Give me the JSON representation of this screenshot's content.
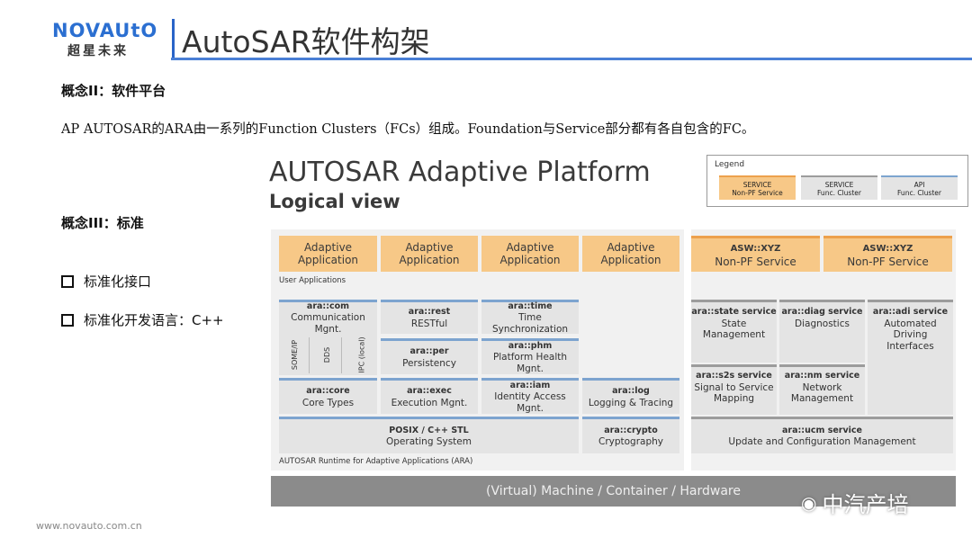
{
  "header": {
    "logo_top": "NOVAUtO",
    "logo_bottom": "超星未来",
    "title": "AutoSAR软件构架"
  },
  "concept2": "概念II：软件平台",
  "paragraph": "AP AUTOSAR的ARA由一系列的Function Clusters（FCs）组成。Foundation与Service部分都有各自包含的FC。",
  "concept3": "概念III：标准",
  "bullets": [
    "标准化接口",
    "标准化开发语言：C++"
  ],
  "diagram": {
    "title": "AUTOSAR Adaptive Platform",
    "subtitle": "Logical view",
    "legend": {
      "title": "Legend",
      "items": [
        {
          "top": "SERVICE",
          "bottom": "Non-PF Service"
        },
        {
          "top": "SERVICE",
          "bottom": "Func. Cluster"
        },
        {
          "top": "API",
          "bottom": "Func. Cluster"
        }
      ]
    },
    "apps": [
      {
        "line1": "Adaptive",
        "line2": "Application"
      },
      {
        "line1": "Adaptive",
        "line2": "Application"
      },
      {
        "line1": "Adaptive",
        "line2": "Application"
      },
      {
        "line1": "Adaptive",
        "line2": "Application"
      }
    ],
    "asw": [
      {
        "line1": "ASW::XYZ",
        "line2": "Non-PF Service"
      },
      {
        "line1": "ASW::XYZ",
        "line2": "Non-PF Service"
      }
    ],
    "user_apps_label": "User Applications",
    "api": {
      "com": {
        "name": "ara::com",
        "desc": "Communication Mgnt."
      },
      "someip": "SOME/IP",
      "dds": "DDS",
      "ipc": "IPC (local)",
      "rest": {
        "name": "ara::rest",
        "desc": "RESTful"
      },
      "time": {
        "name": "ara::time",
        "desc": "Time Synchronization"
      },
      "per": {
        "name": "ara::per",
        "desc": "Persistency"
      },
      "phm": {
        "name": "ara::phm",
        "desc": "Platform Health Mgnt."
      },
      "core": {
        "name": "ara::core",
        "desc": "Core Types"
      },
      "exec": {
        "name": "ara::exec",
        "desc": "Execution Mgnt."
      },
      "iam": {
        "name": "ara::iam",
        "desc": "Identity Access Mgnt."
      },
      "log": {
        "name": "ara::log",
        "desc": "Logging & Tracing"
      },
      "posix": {
        "name": "POSIX / C++ STL",
        "desc": "Operating System"
      },
      "crypto": {
        "name": "ara::crypto",
        "desc": "Cryptography"
      }
    },
    "services": {
      "state": {
        "name": "ara::state service",
        "desc1": "State",
        "desc2": "Management"
      },
      "diag": {
        "name": "ara::diag service",
        "desc1": "Diagnostics",
        "desc2": ""
      },
      "adi": {
        "name": "ara::adi service",
        "desc1": "Automated Driving",
        "desc2": "Interfaces"
      },
      "s2s": {
        "name": "ara::s2s service",
        "desc1": "Signal to Service",
        "desc2": "Mapping"
      },
      "nm": {
        "name": "ara::nm service",
        "desc1": "Network",
        "desc2": "Management"
      },
      "ucm": {
        "name": "ara::ucm service",
        "desc1": "Update and Configuration Management",
        "desc2": ""
      }
    },
    "runtime_label": "AUTOSAR Runtime for Adaptive Applications (ARA)",
    "machine_label": "(Virtual) Machine / Container / Hardware"
  },
  "watermark": "中汽产培",
  "footer": "www.novauto.com.cn",
  "colors": {
    "accent": "#2a64c8",
    "app_orange": "#f7c887",
    "service_border": "#7da4cf",
    "machine_gray": "#8b8b8b"
  }
}
